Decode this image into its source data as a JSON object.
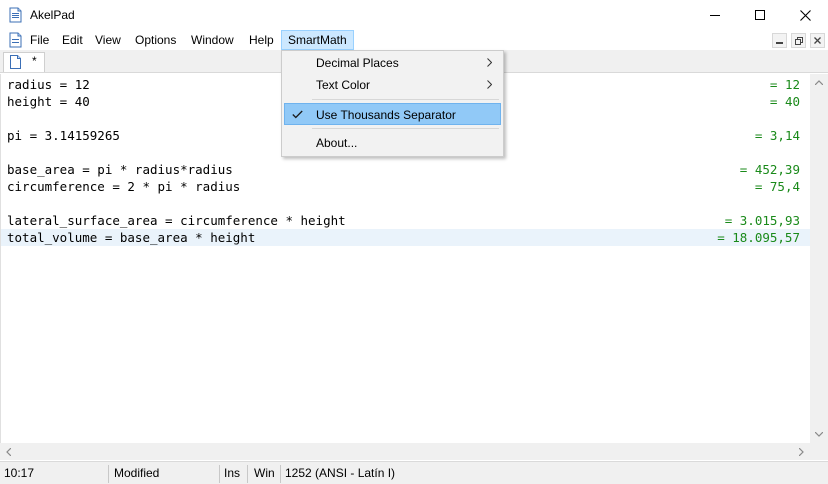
{
  "window": {
    "title": "AkelPad"
  },
  "menubar": {
    "items": [
      "File",
      "Edit",
      "View",
      "Options",
      "Window",
      "Help",
      "SmartMath"
    ],
    "active": "SmartMath"
  },
  "tab": {
    "label": "*"
  },
  "smartmath_menu": {
    "items": [
      {
        "label": "Decimal Places",
        "submenu": true
      },
      {
        "label": "Text Color",
        "submenu": true
      },
      {
        "label": "Use Thousands Separator",
        "checked": true
      },
      {
        "label": "About..."
      }
    ]
  },
  "editor": {
    "lines": [
      {
        "code": "radius = 12",
        "result": "= 12"
      },
      {
        "code": "height = 40",
        "result": "= 40"
      },
      {
        "code": "",
        "result": ""
      },
      {
        "code": "pi = 3.14159265",
        "result": "= 3,14"
      },
      {
        "code": "",
        "result": ""
      },
      {
        "code": "base_area = pi * radius*radius",
        "result": "= 452,39"
      },
      {
        "code": "circumference = 2 * pi * radius",
        "result": "= 75,4"
      },
      {
        "code": "",
        "result": ""
      },
      {
        "code": "lateral_surface_area = circumference * height",
        "result": "= 3.015,93"
      },
      {
        "code": "total_volume = base_area * height",
        "result": "= 18.095,57"
      }
    ],
    "result_color": "#1a8a1a",
    "current_line_color": "#eaf3fb"
  },
  "statusbar": {
    "position": "10:17",
    "modified": "Modified",
    "insert_mode": "Ins",
    "newline": "Win",
    "encoding": "1252  (ANSI - Latín I)"
  }
}
